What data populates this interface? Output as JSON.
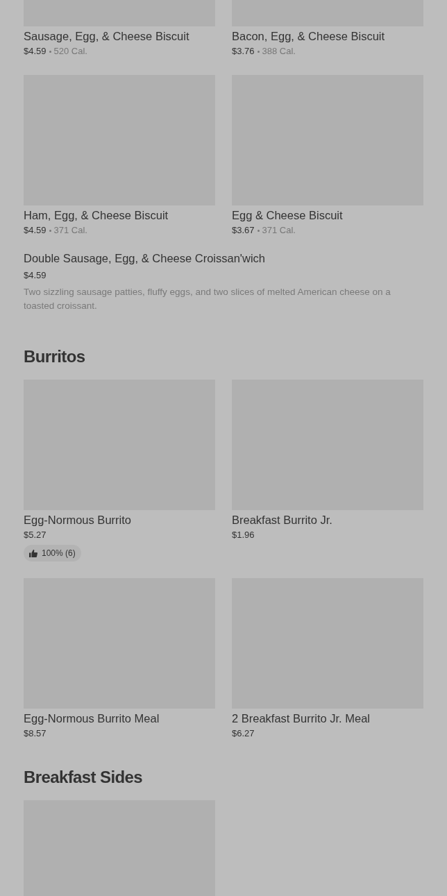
{
  "sections": [
    {
      "items": [
        {
          "kind": "card",
          "name": "Sausage, Egg, & Cheese Biscuit",
          "price": "$4.59",
          "calories": "520 Cal."
        },
        {
          "kind": "card",
          "name": "Bacon, Egg, & Cheese Biscuit",
          "price": "$3.76",
          "calories": "388 Cal."
        },
        {
          "kind": "card",
          "name": "Ham, Egg, & Cheese Biscuit",
          "price": "$4.59",
          "calories": "371 Cal."
        },
        {
          "kind": "card",
          "name": "Egg & Cheese Biscuit",
          "price": "$3.67",
          "calories": "371 Cal."
        },
        {
          "kind": "text",
          "name": "Double Sausage, Egg, & Cheese Croissan'wich",
          "price": "$4.59",
          "description": "Two sizzling sausage patties, fluffy eggs, and two slices of melted American cheese on a toasted croissant."
        }
      ]
    },
    {
      "heading": "Burritos",
      "items": [
        {
          "kind": "card",
          "name": "Egg-Normous Burrito",
          "price": "$5.27",
          "rating": "100% (6)"
        },
        {
          "kind": "card",
          "name": "Breakfast Burrito Jr.",
          "price": "$1.96"
        },
        {
          "kind": "card",
          "name": "Egg-Normous Burrito Meal",
          "price": "$8.57"
        },
        {
          "kind": "card",
          "name": "2 Breakfast Burrito Jr. Meal",
          "price": "$6.27"
        }
      ]
    },
    {
      "heading": "Breakfast Sides",
      "items": [
        {
          "kind": "card"
        }
      ]
    }
  ]
}
